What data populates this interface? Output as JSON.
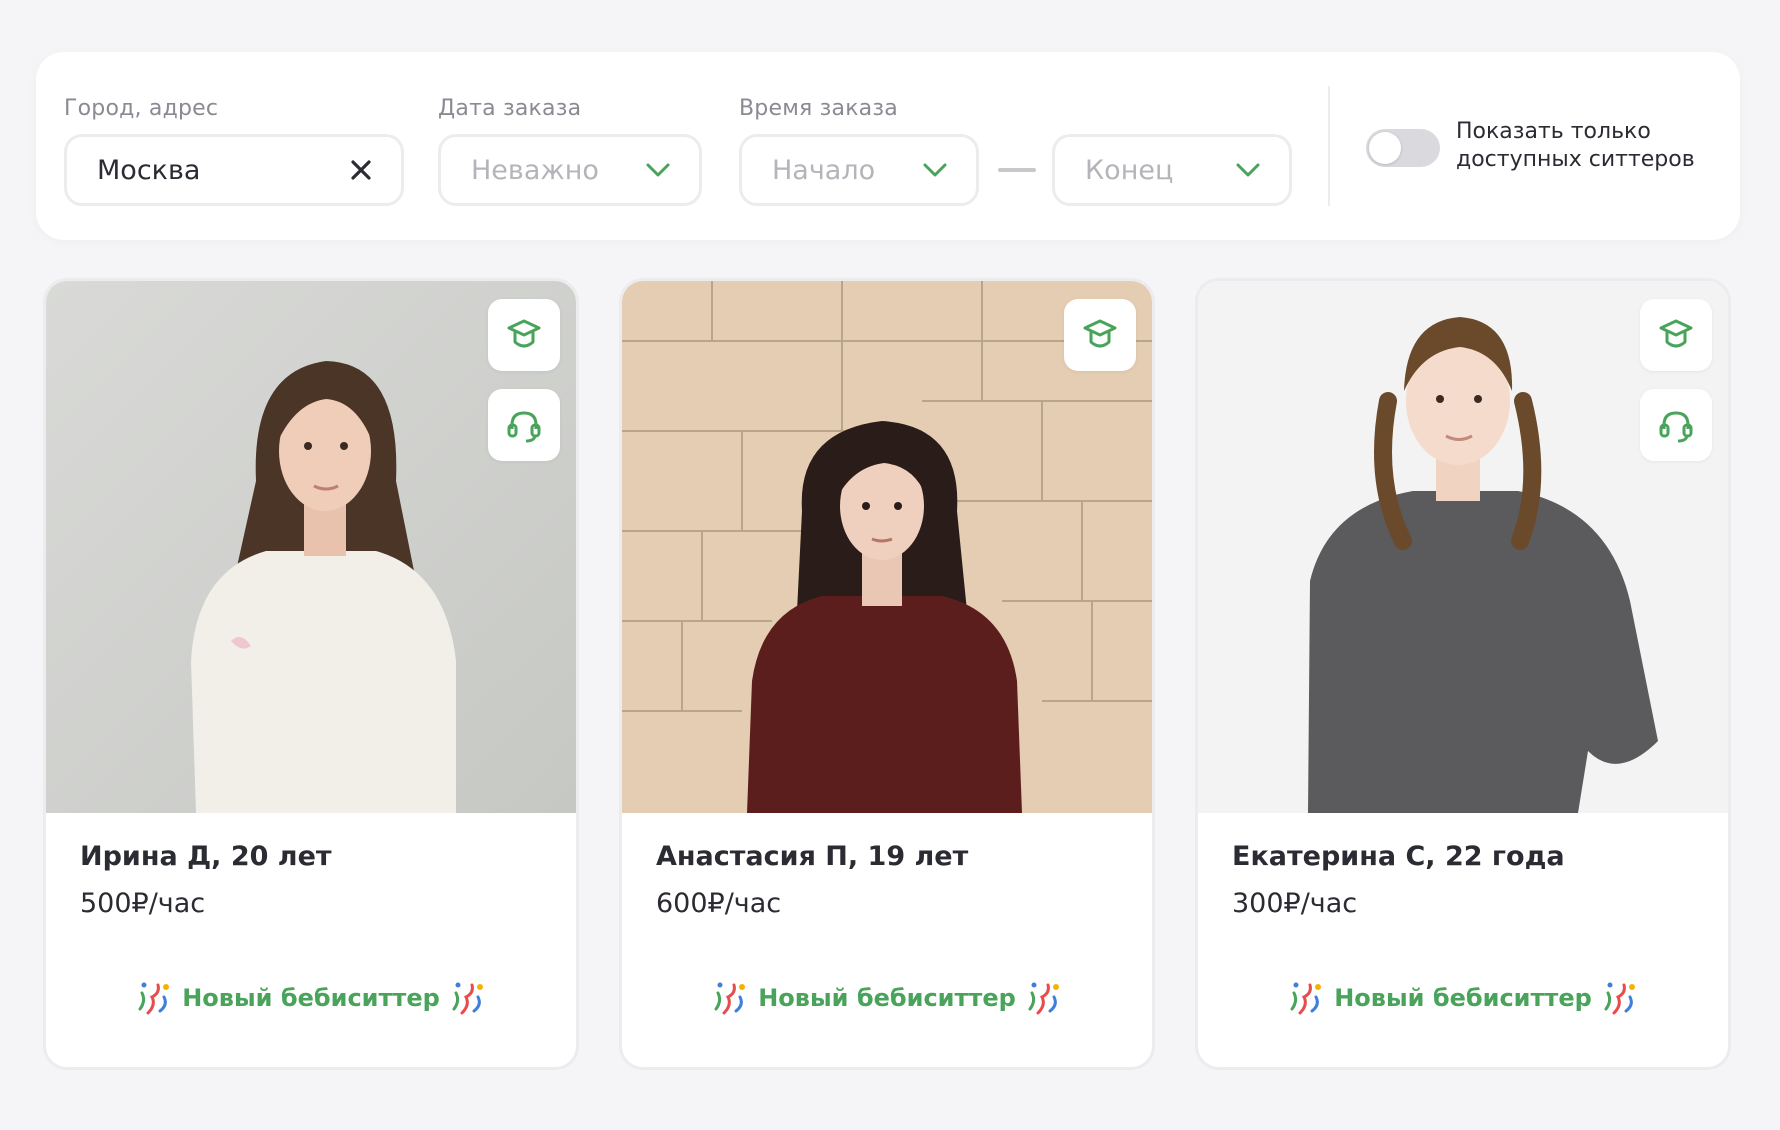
{
  "filters": {
    "city": {
      "label": "Город, адрес",
      "value": "Москва"
    },
    "date": {
      "label": "Дата заказа",
      "placeholder": "Неважно"
    },
    "time": {
      "label": "Время заказа",
      "start_placeholder": "Начало",
      "end_placeholder": "Конец"
    },
    "toggle": {
      "label_line1": "Показать только",
      "label_line2": "доступных ситтеров",
      "on": false
    }
  },
  "colors": {
    "accent_green": "#4aa35a",
    "text": "#2b2b33",
    "muted": "#8a8a92",
    "border": "#ececef"
  },
  "cards": [
    {
      "name": "Ирина Д, 20 лет",
      "price": "500₽/час",
      "badge": "Новый бебиситтер",
      "icons": [
        "graduation-cap-icon",
        "headset-icon"
      ]
    },
    {
      "name": "Анастасия П, 19 лет",
      "price": "600₽/час",
      "badge": "Новый бебиситтер",
      "icons": [
        "graduation-cap-icon"
      ]
    },
    {
      "name": "Екатерина С, 22 года",
      "price": "300₽/час",
      "badge": "Новый бебиситтер",
      "icons": [
        "graduation-cap-icon",
        "headset-icon"
      ]
    }
  ]
}
